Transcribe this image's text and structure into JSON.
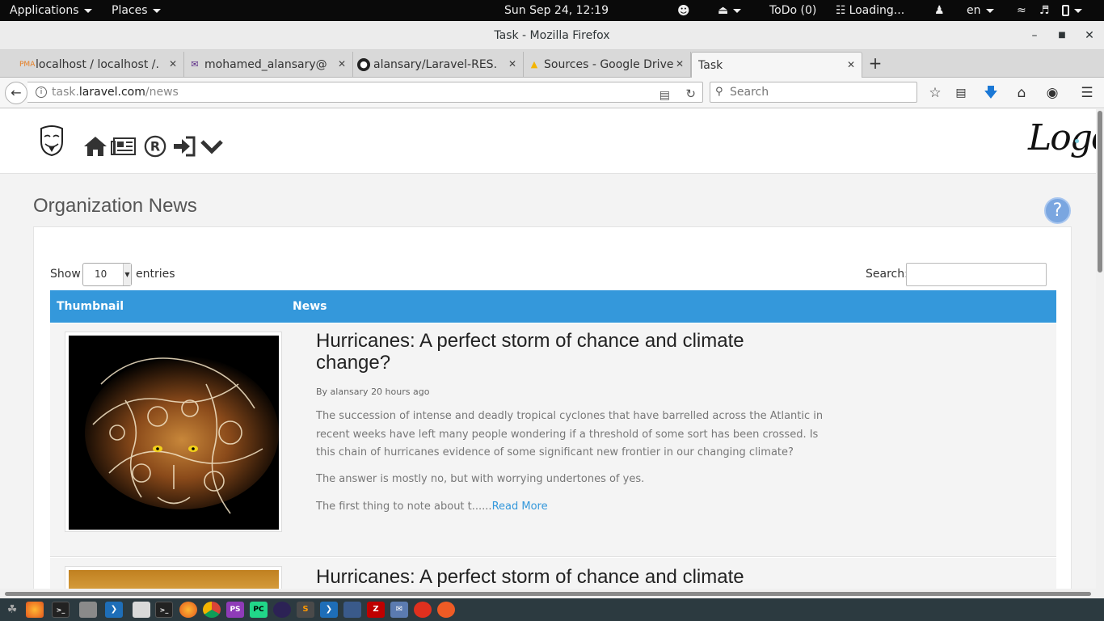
{
  "topbar": {
    "applications": "Applications",
    "places": "Places",
    "clock": "Sun Sep 24, 12:19",
    "todo": "ToDo (0)",
    "loading": "Loading...",
    "lang": "en"
  },
  "window": {
    "title": "Task - Mozilla Firefox"
  },
  "tabs": [
    {
      "label": "localhost / localhost /...",
      "icon": "phpmyadmin-icon"
    },
    {
      "label": "mohamed_alansary@...",
      "icon": "mail-icon"
    },
    {
      "label": "alansary/Laravel-RES...",
      "icon": "github-icon"
    },
    {
      "label": "Sources - Google Drive",
      "icon": "google-drive-icon"
    },
    {
      "label": "Task",
      "icon": ""
    }
  ],
  "navbar": {
    "url_prefix": "task.",
    "url_host": "laravel.com",
    "url_path": "/news",
    "search_placeholder": "Search"
  },
  "site": {
    "logo": "Logo",
    "page_title": "Organization News",
    "help": "?"
  },
  "table": {
    "show_label": "Show",
    "entries_value": "10",
    "entries_label": "entries",
    "search_label": "Search:",
    "columns": [
      "Thumbnail",
      "News"
    ]
  },
  "news": [
    {
      "title": "Hurricanes: A perfect storm of chance and climate change?",
      "meta": "By alansary 20 hours ago",
      "p1": "The succession of intense and deadly tropical cyclones that have barrelled across the Atlantic in recent weeks have left many people wondering if a threshold of some sort has been crossed. Is this chain of hurricanes evidence of some significant new frontier in our changing climate?",
      "p2": "The answer is mostly no, but with worrying undertones of yes.",
      "p3": "The first thing to note about t......",
      "read_more": "Read More"
    },
    {
      "title": "Hurricanes: A perfect storm of chance and climate"
    }
  ],
  "taskbar": {
    "apps": [
      "gnome-foot-icon",
      "firefox-icon",
      "terminal-icon",
      "files-icon",
      "vscode-icon",
      "text-editor-icon",
      "terminal-2-icon",
      "firefox-2-icon",
      "chrome-icon",
      "phpstorm-icon",
      "pycharm-icon",
      "eclipse-icon",
      "sublime-icon",
      "vscode-2-icon",
      "network-icon",
      "filezilla-icon",
      "mail-client-icon",
      "unity-icon",
      "postman-icon"
    ]
  }
}
